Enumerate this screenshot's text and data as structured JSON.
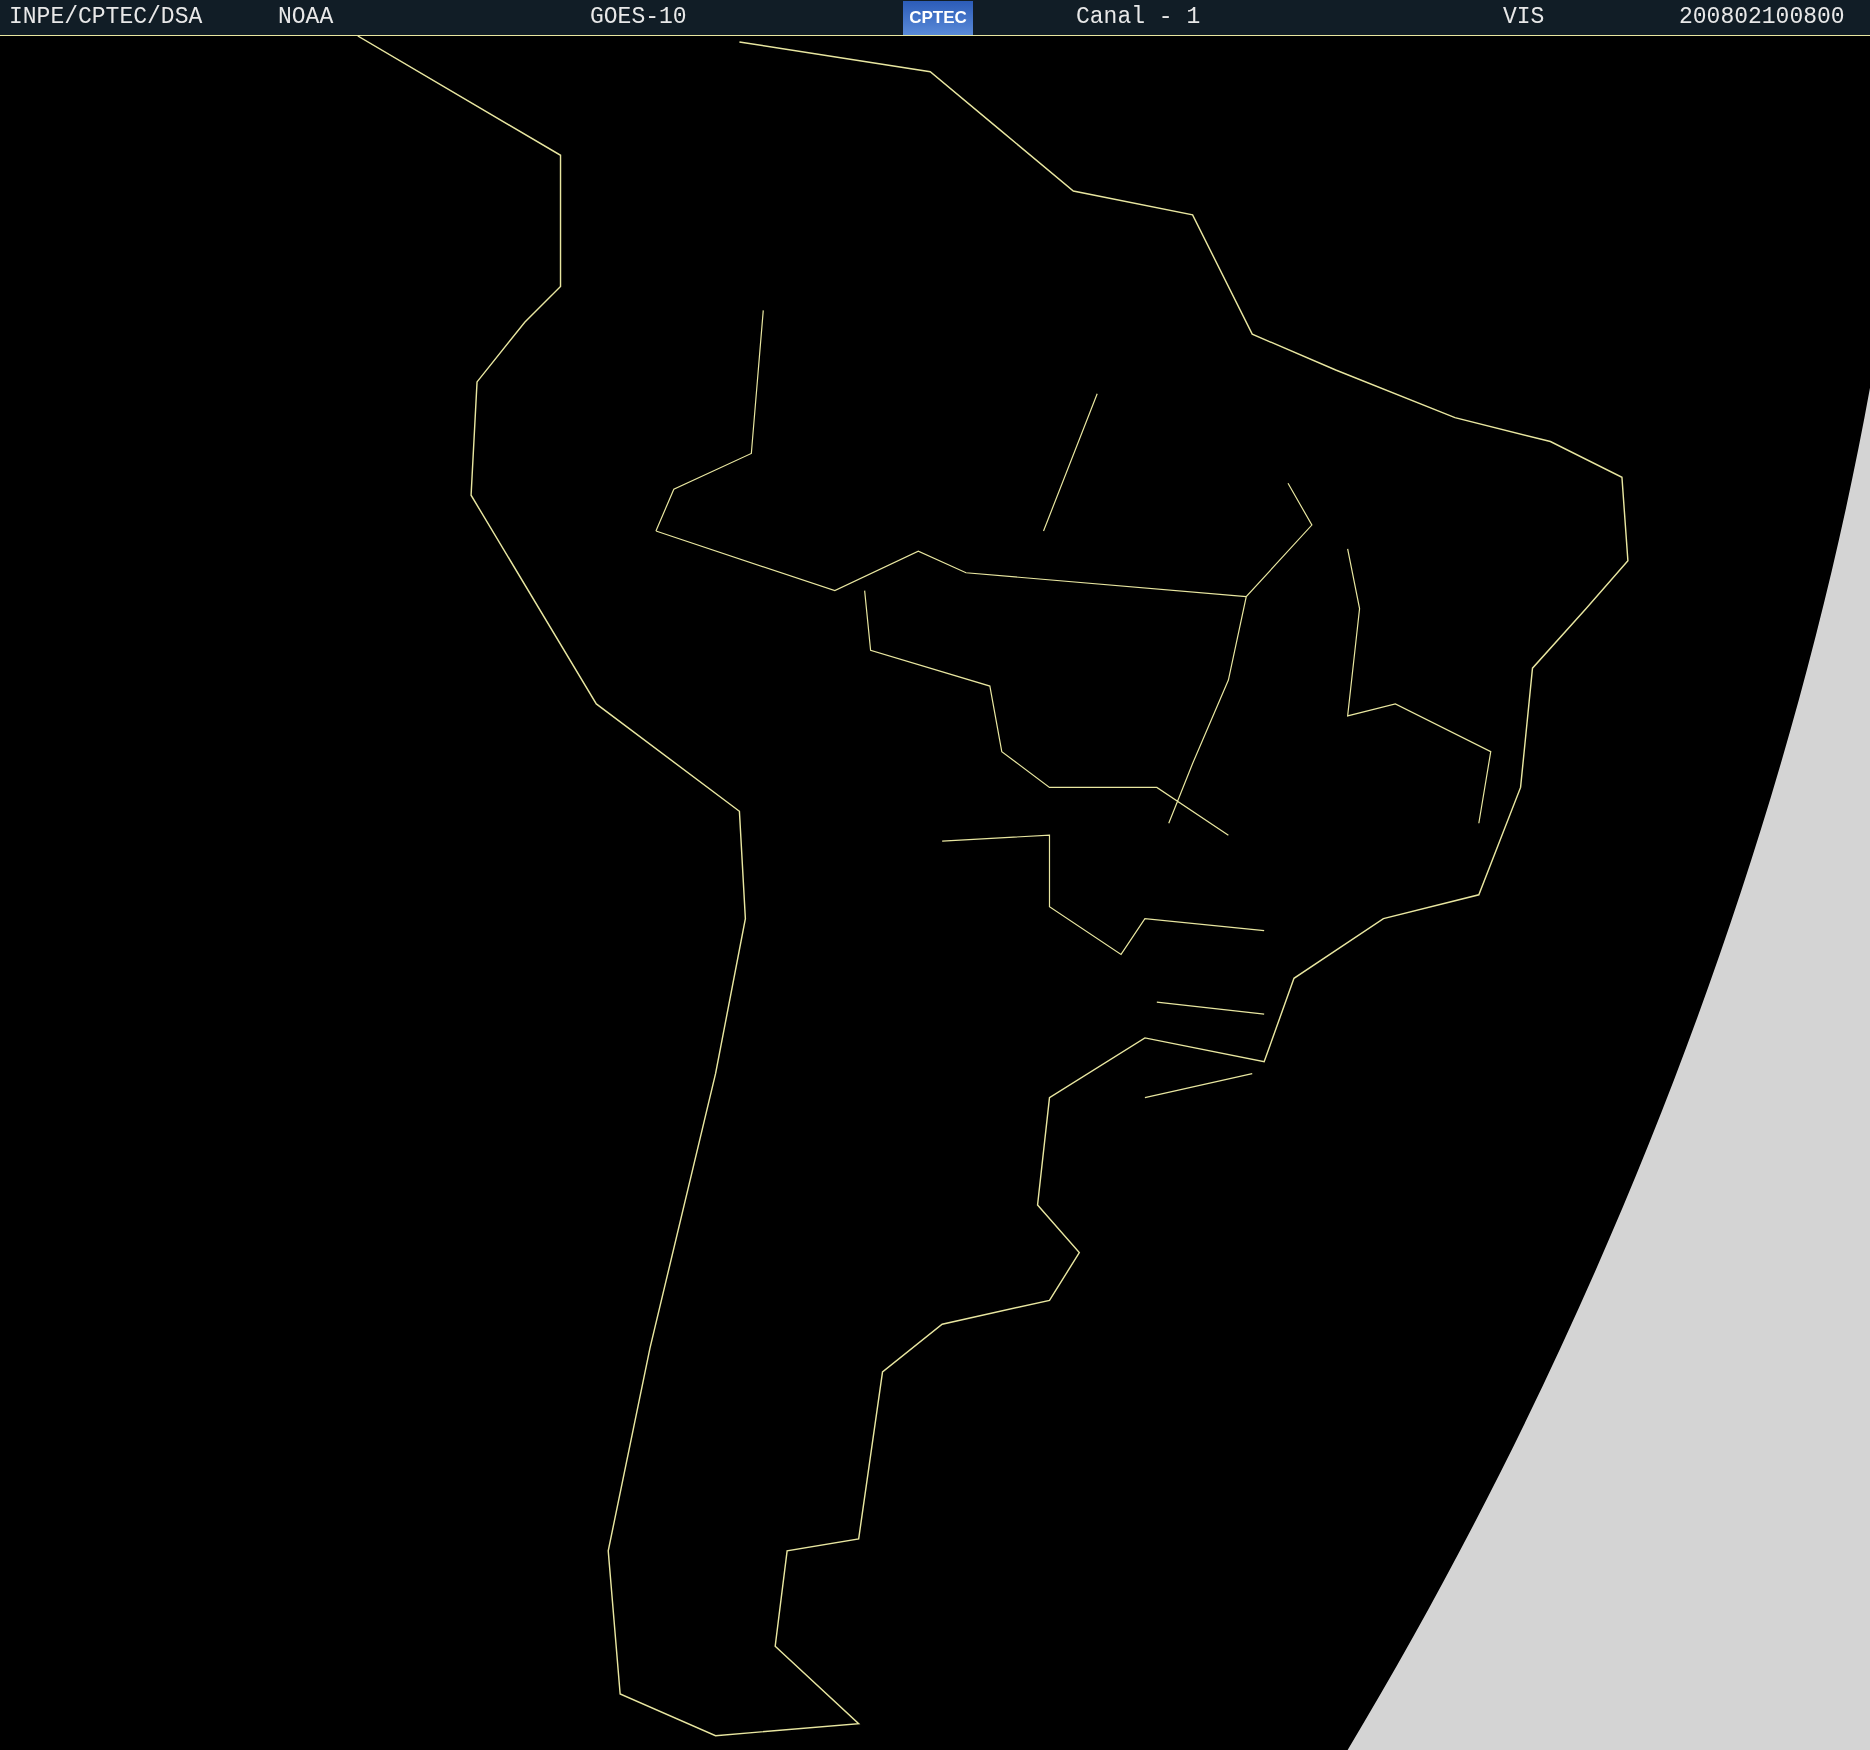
{
  "header": {
    "agency": "INPE/CPTEC/DSA",
    "source": "NOAA",
    "satellite": "GOES-10",
    "logo": "CPTEC",
    "channel": "Canal - 1",
    "band": "VIS",
    "timestamp": "200802100800"
  }
}
